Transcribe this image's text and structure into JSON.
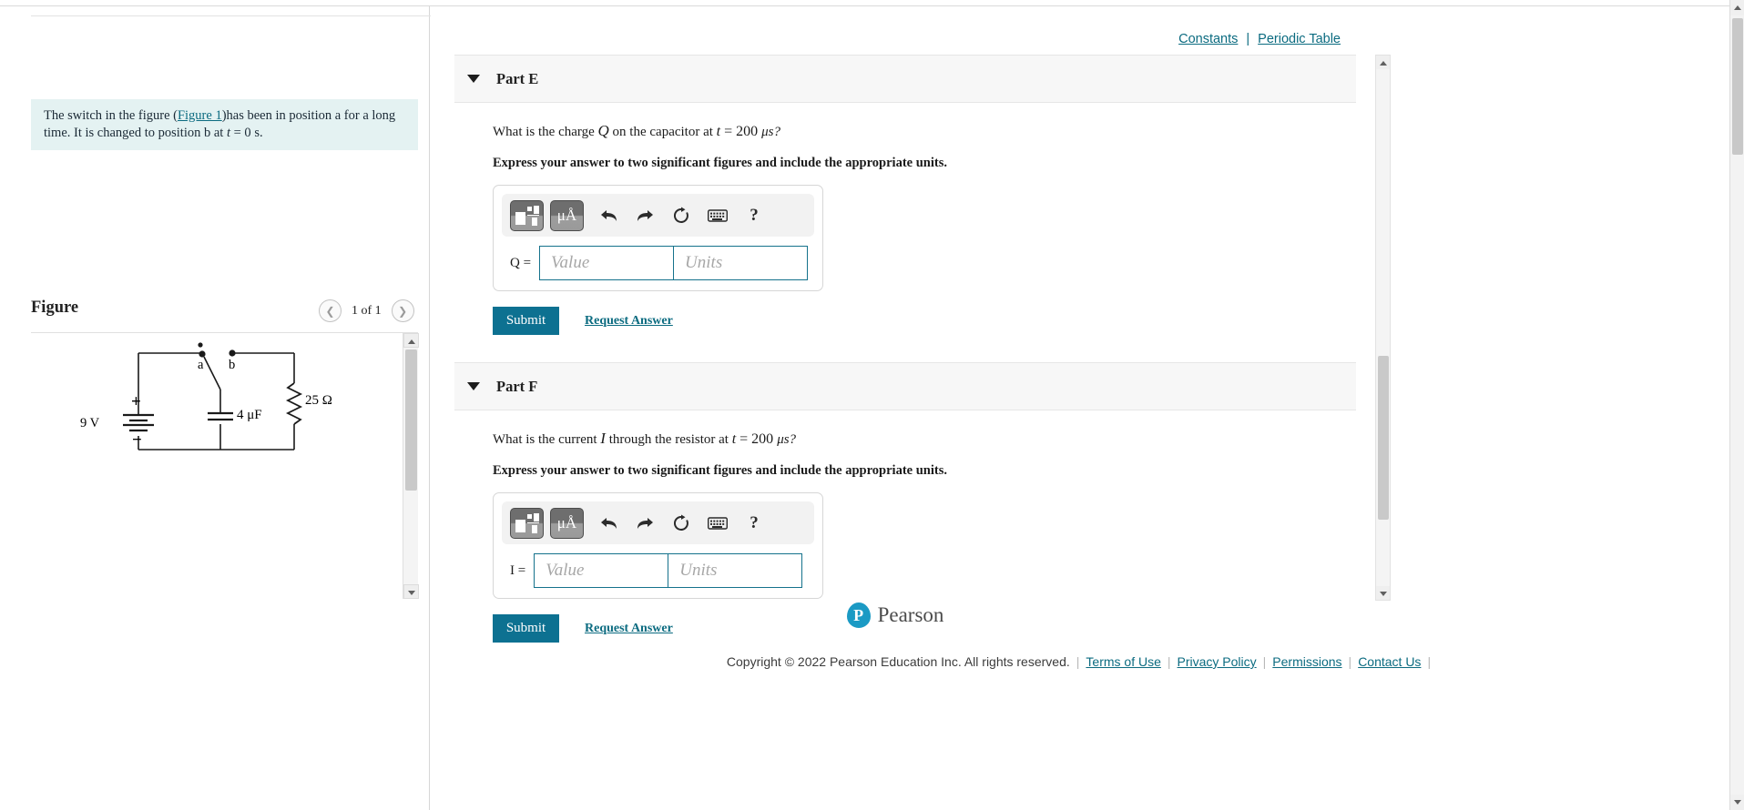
{
  "header": {
    "constants_link": "Constants",
    "separator": "|",
    "periodic_table_link": "Periodic Table"
  },
  "problem": {
    "text_before_link": "The switch in the figure (",
    "link": "Figure 1",
    "text_after_link": ")has been in position a for a long time. It is changed to position b at ",
    "math_t": "t",
    "math_eq": " = 0",
    "text_end": " s."
  },
  "figure": {
    "title": "Figure",
    "prev_icon": "chevron-left-icon",
    "next_icon": "chevron-right-icon",
    "counter": "1 of 1",
    "circuit": {
      "voltage_label": "9 V",
      "plus_sign": "+",
      "minus_sign": "−",
      "switch_a": "a",
      "switch_b": "b",
      "capacitor_label": "4 μF",
      "resistor_label": "25 Ω"
    }
  },
  "parts": [
    {
      "id": "part-e",
      "caret_icon": "caret-down-icon",
      "title": "Part E",
      "question_prefix": "What is the charge ",
      "question_symbol": "Q",
      "question_middle": " on the capacitor at ",
      "question_t": "t",
      "question_value": " = 200 ",
      "question_unit": "μs?",
      "instruction": "Express your answer to two significant figures and include the appropriate units.",
      "toolbar": {
        "template_icon": "math-template-icon",
        "units_label": "μÅ",
        "undo_icon": "undo-icon",
        "redo_icon": "redo-icon",
        "reset_icon": "reset-icon",
        "keyboard_icon": "keyboard-icon",
        "help_label": "?"
      },
      "field_label": "Q =",
      "value_placeholder": "Value",
      "units_placeholder": "Units",
      "submit_label": "Submit",
      "request_label": "Request Answer"
    },
    {
      "id": "part-f",
      "caret_icon": "caret-down-icon",
      "title": "Part F",
      "question_prefix": "What is the current ",
      "question_symbol": "I",
      "question_middle": " through the resistor at ",
      "question_t": "t",
      "question_value": " = 200 ",
      "question_unit": "μs?",
      "instruction": "Express your answer to two significant figures and include the appropriate units.",
      "toolbar": {
        "template_icon": "math-template-icon",
        "units_label": "μÅ",
        "undo_icon": "undo-icon",
        "redo_icon": "redo-icon",
        "reset_icon": "reset-icon",
        "keyboard_icon": "keyboard-icon",
        "help_label": "?"
      },
      "field_label": "I =",
      "value_placeholder": "Value",
      "units_placeholder": "Units",
      "submit_label": "Submit",
      "request_label": "Request Answer"
    }
  ],
  "brand": {
    "mark": "P",
    "name": "Pearson"
  },
  "footer": {
    "copyright": "Copyright © 2022 Pearson Education Inc. All rights reserved.",
    "links": [
      "Terms of Use",
      "Privacy Policy",
      "Permissions",
      "Contact Us"
    ]
  },
  "colors": {
    "accent": "#0d7191",
    "link": "#0b6b80",
    "problem_bg": "#e4f2f2",
    "part_header_bg": "#f7f7f7",
    "field_border": "#15728c"
  }
}
